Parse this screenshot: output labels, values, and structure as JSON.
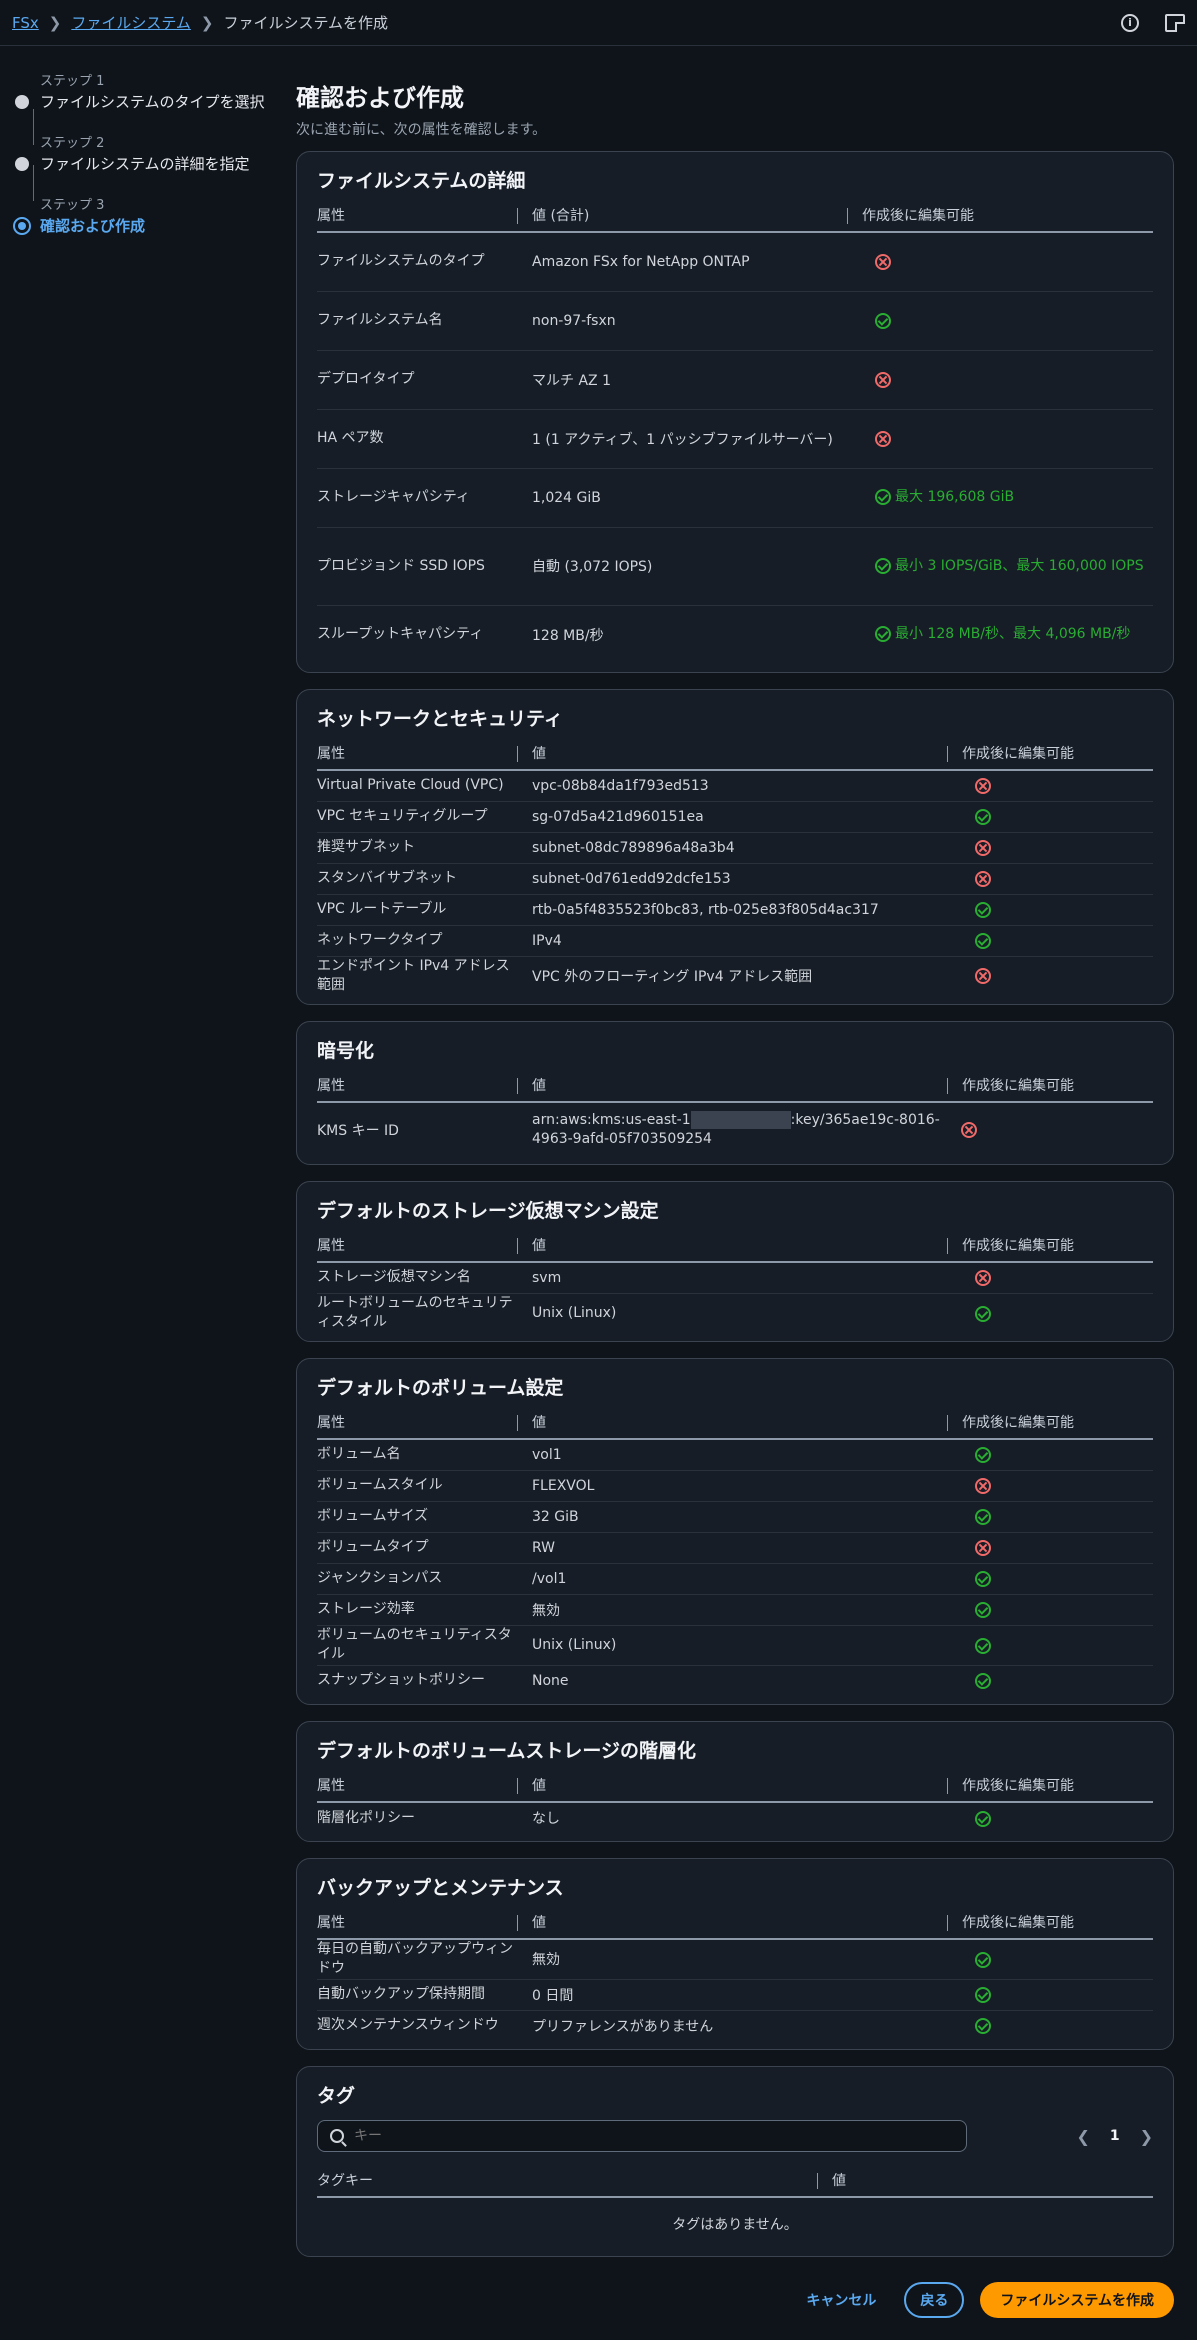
{
  "breadcrumb": {
    "root": "FSx",
    "level2": "ファイルシステム",
    "current": "ファイルシステムを作成"
  },
  "steps": [
    {
      "label": "ステップ 1",
      "name": "ファイルシステムのタイプを選択"
    },
    {
      "label": "ステップ 2",
      "name": "ファイルシステムの詳細を指定"
    },
    {
      "label": "ステップ 3",
      "name": "確認および作成"
    }
  ],
  "page": {
    "title": "確認および作成",
    "subtitle": "次に進む前に、次の属性を確認します。"
  },
  "sections": {
    "fs": {
      "title": "ファイルシステムの詳細",
      "headers": [
        "属性",
        "値 (合計)",
        "作成後に編集可能"
      ],
      "rows": [
        {
          "attr": "ファイルシステムのタイプ",
          "value": "Amazon FSx for NetApp ONTAP",
          "editable": false,
          "note": ""
        },
        {
          "attr": "ファイルシステム名",
          "value": "non-97-fsxn",
          "editable": true,
          "note": ""
        },
        {
          "attr": "デプロイタイプ",
          "value": "マルチ AZ 1",
          "editable": false,
          "note": ""
        },
        {
          "attr": "HA ペア数",
          "value": "1 (1 アクティブ、1 パッシブファイルサーバー)",
          "editable": false,
          "note": ""
        },
        {
          "attr": "ストレージキャパシティ",
          "value": "1,024 GiB",
          "editable": true,
          "note": "最大 196,608 GiB"
        },
        {
          "attr": "プロビジョンド SSD IOPS",
          "value": "自動 (3,072 IOPS)",
          "editable": true,
          "note": "最小 3 IOPS/GiB、最大 160,000 IOPS"
        },
        {
          "attr": "スループットキャパシティ",
          "value": "128 MB/秒",
          "editable": true,
          "note": "最小 128 MB/秒、最大 4,096 MB/秒"
        }
      ]
    },
    "net": {
      "title": "ネットワークとセキュリティ",
      "headers": [
        "属性",
        "値",
        "作成後に編集可能"
      ],
      "rows": [
        {
          "attr": "Virtual Private Cloud (VPC)",
          "value": "vpc-08b84da1f793ed513",
          "editable": false
        },
        {
          "attr": "VPC セキュリティグループ",
          "value": "sg-07d5a421d960151ea",
          "editable": true
        },
        {
          "attr": "推奨サブネット",
          "value": "subnet-08dc789896a48a3b4",
          "editable": false
        },
        {
          "attr": "スタンバイサブネット",
          "value": "subnet-0d761edd92dcfe153",
          "editable": false
        },
        {
          "attr": "VPC ルートテーブル",
          "value": "rtb-0a5f4835523f0bc83, rtb-025e83f805d4ac317",
          "editable": true
        },
        {
          "attr": "ネットワークタイプ",
          "value": "IPv4",
          "editable": true
        },
        {
          "attr": "エンドポイント IPv4 アドレス範囲",
          "value": "VPC 外のフローティング IPv4 アドレス範囲",
          "editable": false
        }
      ]
    },
    "enc": {
      "title": "暗号化",
      "headers": [
        "属性",
        "値",
        "作成後に編集可能"
      ],
      "row": {
        "attr": "KMS キー ID",
        "value_pre": "arn:aws:kms:us-east-1",
        "value_post": ":key/365ae19c-8016-4963-9afd-05f703509254",
        "editable": false
      }
    },
    "svm": {
      "title": "デフォルトのストレージ仮想マシン設定",
      "headers": [
        "属性",
        "値",
        "作成後に編集可能"
      ],
      "rows": [
        {
          "attr": "ストレージ仮想マシン名",
          "value": "svm",
          "editable": false
        },
        {
          "attr": "ルートボリュームのセキュリティスタイル",
          "value": "Unix (Linux)",
          "editable": true
        }
      ]
    },
    "vol": {
      "title": "デフォルトのボリューム設定",
      "headers": [
        "属性",
        "値",
        "作成後に編集可能"
      ],
      "rows": [
        {
          "attr": "ボリューム名",
          "value": "vol1",
          "editable": true
        },
        {
          "attr": "ボリュームスタイル",
          "value": "FLEXVOL",
          "editable": false
        },
        {
          "attr": "ボリュームサイズ",
          "value": "32 GiB",
          "editable": true
        },
        {
          "attr": "ボリュームタイプ",
          "value": "RW",
          "editable": false
        },
        {
          "attr": "ジャンクションパス",
          "value": "/vol1",
          "editable": true
        },
        {
          "attr": "ストレージ効率",
          "value": "無効",
          "editable": true
        },
        {
          "attr": "ボリュームのセキュリティスタイル",
          "value": "Unix (Linux)",
          "editable": true
        },
        {
          "attr": "スナップショットポリシー",
          "value": "None",
          "editable": true
        }
      ]
    },
    "tier": {
      "title": "デフォルトのボリュームストレージの階層化",
      "headers": [
        "属性",
        "値",
        "作成後に編集可能"
      ],
      "rows": [
        {
          "attr": "階層化ポリシー",
          "value": "なし",
          "editable": true
        }
      ]
    },
    "bk": {
      "title": "バックアップとメンテナンス",
      "headers": [
        "属性",
        "値",
        "作成後に編集可能"
      ],
      "rows": [
        {
          "attr": "毎日の自動バックアップウィンドウ",
          "value": "無効",
          "editable": true
        },
        {
          "attr": "自動バックアップ保持期間",
          "value": "0 日間",
          "editable": true
        },
        {
          "attr": "週次メンテナンスウィンドウ",
          "value": "プリファレンスがありません",
          "editable": true
        }
      ]
    },
    "tags": {
      "title": "タグ",
      "search_placeholder": "キー",
      "page": "1",
      "headers": [
        "タグキー",
        "値"
      ],
      "empty": "タグはありません。"
    }
  },
  "footer": {
    "cancel": "キャンセル",
    "back": "戻る",
    "create": "ファイルシステムを作成"
  },
  "colors": {
    "accent": "#5aa9f0",
    "ok": "#29ad32",
    "no": "#f06a6a",
    "primary": "#ff9900"
  }
}
